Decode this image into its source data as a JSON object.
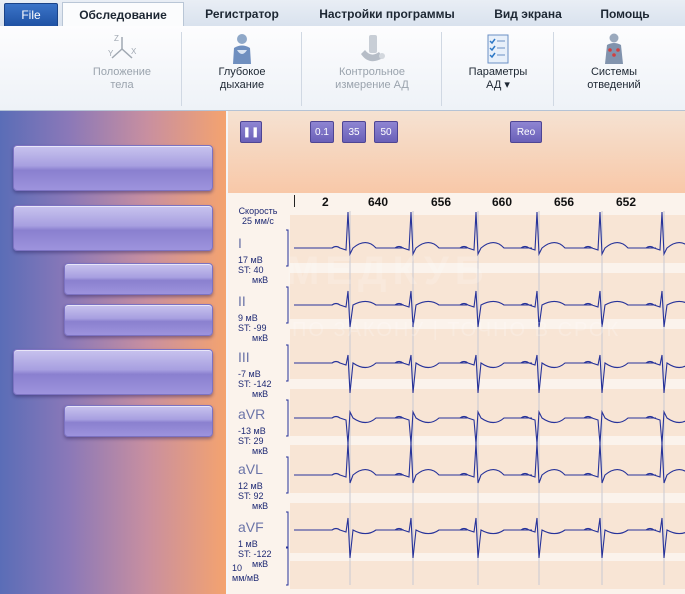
{
  "menu": {
    "file": "File",
    "tabs": [
      "Обследование",
      "Регистратор",
      "Настройки программы",
      "Вид экрана",
      "Помощь"
    ]
  },
  "ribbon": {
    "groups": [
      {
        "line1": "Положение",
        "line2": "тела",
        "enabled": false,
        "icon": "body-position-axes-icon"
      },
      {
        "line1": "Глубокое",
        "line2": "дыхание",
        "enabled": true,
        "icon": "deep-breathing-icon"
      },
      {
        "line1": "Контрольное",
        "line2": "измерение АД",
        "enabled": false,
        "icon": "blood-pressure-control-icon"
      },
      {
        "line1": "Параметры",
        "line2": "АД ▾",
        "enabled": true,
        "icon": "bp-parameters-checklist-icon"
      },
      {
        "line1": "Системы",
        "line2": "отведений",
        "enabled": true,
        "icon": "lead-systems-icon"
      }
    ],
    "icon_labels": {
      "z": "Z",
      "y": "Y",
      "x": "X"
    }
  },
  "toolbar": {
    "pause": "❚❚",
    "filter1": "0.1",
    "filter2": "35",
    "filter3": "50",
    "reo": "Reo"
  },
  "ecg": {
    "speed_label": "Скорость\n25 мм/с",
    "scale_label": "10\nмм/мВ",
    "rr_intervals": [
      "2",
      "640",
      "656",
      "660",
      "656",
      "652"
    ],
    "leads": [
      {
        "name": "I",
        "amp": "17 мВ",
        "st": "ST: 40",
        "unit": "мкВ"
      },
      {
        "name": "II",
        "amp": "9 мВ",
        "st": "ST: -99",
        "unit": "мкВ"
      },
      {
        "name": "III",
        "amp": "-7 мВ",
        "st": "ST: -142",
        "unit": "мкВ"
      },
      {
        "name": "aVR",
        "amp": "-13 мВ",
        "st": "ST: 29",
        "unit": "мкВ"
      },
      {
        "name": "aVL",
        "amp": "12 мВ",
        "st": "ST: 92",
        "unit": "мкВ"
      },
      {
        "name": "aVF",
        "amp": "1 мВ",
        "st": "ST: -122",
        "unit": "мкВ"
      }
    ]
  },
  "watermark": {
    "main": "МЕДКУБ",
    "sub": "ПО ЗАКОНУ | ТОЧНО В СРОК"
  },
  "colors": {
    "accent": "#1f52a4",
    "trace": "#27339a",
    "panel_left": "#5a6db7",
    "panel_right": "#f4a36f"
  }
}
